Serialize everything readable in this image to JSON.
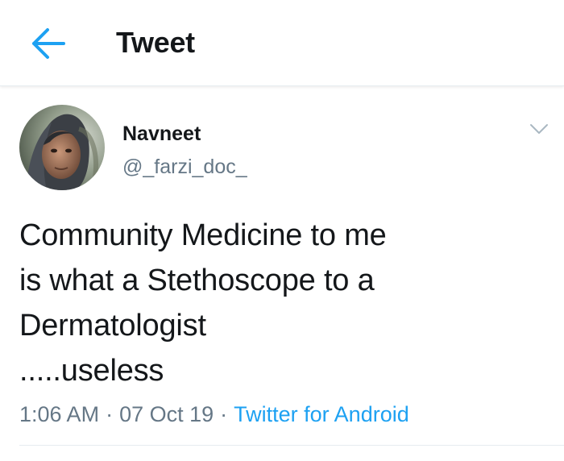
{
  "header": {
    "title": "Tweet",
    "back_icon": "arrow-left-icon",
    "accent_color": "#1da1f2"
  },
  "author": {
    "name": "Navneet",
    "handle": "@_farzi_doc_",
    "avatar_icon": "avatar-photo"
  },
  "tweet": {
    "lines": [
      "Community Medicine to me",
      "is what a Stethoscope to a",
      "Dermatologist",
      ".....useless"
    ],
    "time": "1:06 AM",
    "date": "07 Oct 19",
    "source": "Twitter for Android",
    "separator": "·",
    "menu_icon": "chevron-down-icon"
  }
}
